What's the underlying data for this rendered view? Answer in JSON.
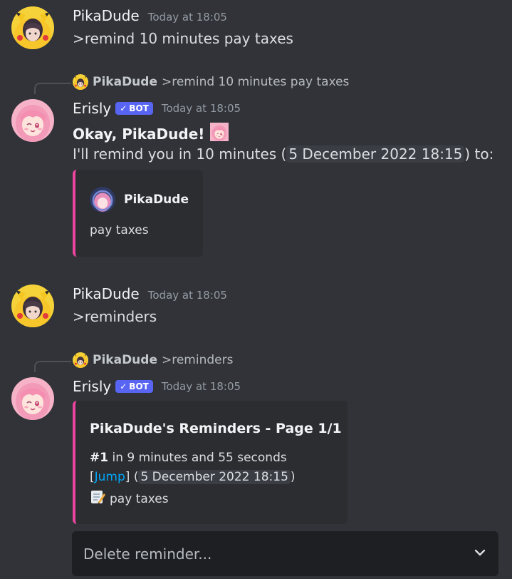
{
  "messages": [
    {
      "author": "PikaDude",
      "time": "Today at 18:05",
      "text": ">remind 10 minutes pay taxes"
    },
    {
      "reply_author": "PikaDude",
      "reply_text": ">remind 10 minutes pay taxes",
      "author": "Erisly",
      "badge": "BOT",
      "time": "Today at 18:05",
      "line1": "Okay, PikaDude!",
      "line2_pre": "I'll remind you in 10 minutes (",
      "line2_ts": "5 December 2022 18:15",
      "line2_post": ") to:",
      "embed_author": "PikaDude",
      "embed_text": "pay taxes"
    },
    {
      "author": "PikaDude",
      "time": "Today at 18:05",
      "text": ">reminders"
    },
    {
      "reply_author": "PikaDude",
      "reply_text": ">reminders",
      "author": "Erisly",
      "badge": "BOT",
      "time": "Today at 18:05",
      "embed_title": "PikaDude's Reminders - Page 1/1",
      "item_num": "#1",
      "item_when": " in 9 minutes and 55 seconds",
      "jump_open": "[",
      "jump_label": "Jump",
      "jump_close": "] (",
      "item_ts": "5 December 2022 18:15",
      "item_ts_close": ")",
      "item_text": "pay taxes"
    }
  ],
  "select": {
    "placeholder": "Delete reminder..."
  },
  "icons": {
    "pikadude_avatar": "pikachu-hood-avatar",
    "erisly_avatar": "pink-hair-anime-avatar",
    "memo": "memo-icon",
    "check": "check-icon",
    "chevron": "chevron-down-icon"
  },
  "colors": {
    "background": "#313338",
    "embed_bar": "#eb459f",
    "bot_badge": "#5865f2",
    "link": "#00a8fc"
  }
}
